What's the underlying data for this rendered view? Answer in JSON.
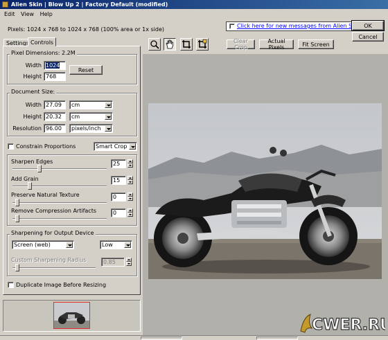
{
  "window": {
    "title": "Alien Skin | Blow Up 2 | Factory Default (modified)"
  },
  "menu": [
    "Edit",
    "View",
    "Help"
  ],
  "info_text": "Pixels: 1024 x 768 to 1024 x 768 (100% area or 1x side)",
  "message_link": "Click here for new messages from Alien Skin",
  "dialog_buttons": {
    "ok": "OK",
    "cancel": "Cancel"
  },
  "tabs": [
    "Settings",
    "Controls"
  ],
  "active_tab": "Controls",
  "pixel_dimensions": {
    "legend": "Pixel Dimensions: 2.2M",
    "width_label": "Width",
    "width_value": "1024",
    "height_label": "Height",
    "height_value": "768",
    "reset_label": "Reset"
  },
  "document_size": {
    "legend": "Document Size:",
    "width_label": "Width",
    "width_value": "27.09",
    "width_unit": "cm",
    "height_label": "Height",
    "height_value": "20.32",
    "height_unit": "cm",
    "resolution_label": "Resolution",
    "resolution_value": "96.00",
    "resolution_unit": "pixels/inch"
  },
  "constrain": {
    "label": "Constrain Proportions",
    "checked": false,
    "mode": "Smart Crop"
  },
  "sliders": {
    "sharpen_edges": {
      "label": "Sharpen Edges",
      "value": "25"
    },
    "add_grain": {
      "label": "Add Grain",
      "value": "15"
    },
    "preserve_texture": {
      "label": "Preserve Natural Texture",
      "value": "0"
    },
    "remove_artifacts": {
      "label": "Remove Compression Artifacts",
      "value": "0"
    }
  },
  "output_sharpening": {
    "legend": "Sharpening for Output Device",
    "device": "Screen (web)",
    "amount": "Low",
    "radius_label": "Custom Sharpening Radius",
    "radius_value": "0.85"
  },
  "duplicate": {
    "label": "Duplicate Image Before Resizing",
    "checked": false
  },
  "toolbar": {
    "icons": [
      "zoom-icon",
      "hand-icon",
      "crop-icon",
      "crop-settings-icon"
    ],
    "clear_crop": "Clear Crop",
    "actual_pixels": "Actual Pixels",
    "fit_screen": "Fit Screen"
  },
  "watermark": {
    "text": "CWER.RU"
  },
  "colors": {
    "title_start": "#0a246a",
    "title_end": "#3a6ea5",
    "link": "#0000ff",
    "thumb_border": "#e03030"
  }
}
